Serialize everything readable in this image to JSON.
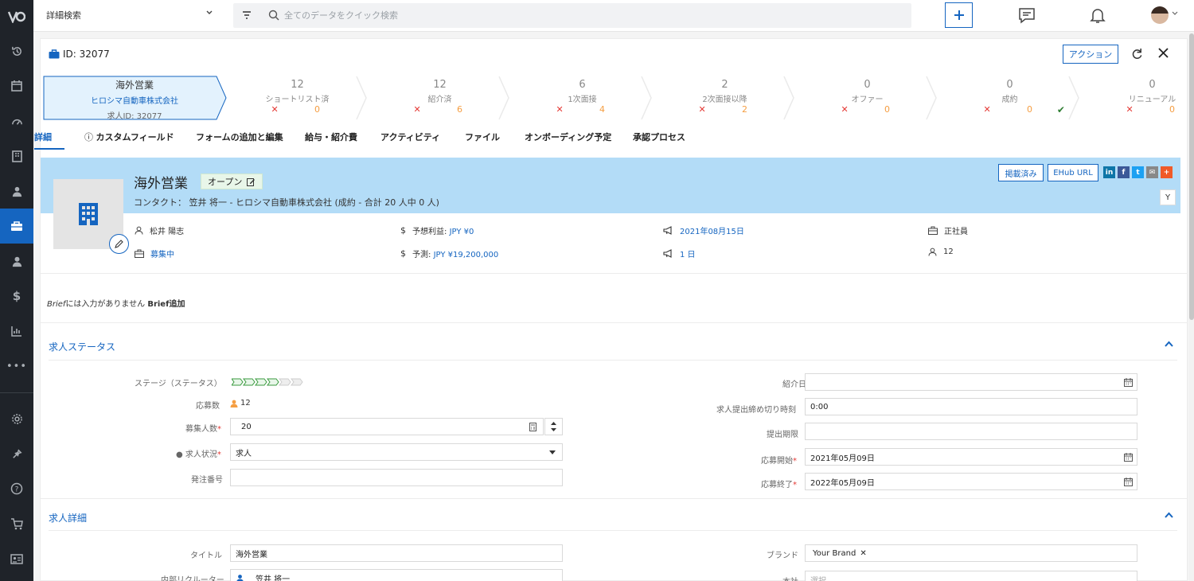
{
  "topbar": {
    "search_type": "詳細検索",
    "quick_search_placeholder": "全てのデータをクイック検索"
  },
  "header": {
    "id_label": "ID: 32077",
    "action_button": "アクション"
  },
  "pipeline": {
    "first": {
      "title": "海外営業",
      "company": "ヒロシマ自動車株式会社",
      "job_id": "求人ID: 32077"
    },
    "stages": [
      {
        "count": "12",
        "name": "ショートリスト済",
        "num": "0",
        "ok": false
      },
      {
        "count": "12",
        "name": "紹介済",
        "num": "6",
        "ok": false
      },
      {
        "count": "6",
        "name": "1次面接",
        "num": "4",
        "ok": false
      },
      {
        "count": "2",
        "name": "2次面接以降",
        "num": "2",
        "ok": false
      },
      {
        "count": "0",
        "name": "オファー",
        "num": "0",
        "ok": false
      },
      {
        "count": "0",
        "name": "成約",
        "num": "0",
        "ok": true
      },
      {
        "count": "0",
        "name": "リニューアル",
        "num": "0",
        "ok": true
      }
    ]
  },
  "tabs": [
    "詳細",
    "カスタムフィールド",
    "フォームの追加と編集",
    "給与・紹介費",
    "アクティビティ",
    "ファイル",
    "オンボーディング予定",
    "承認プロセス"
  ],
  "banner": {
    "title": "海外営業",
    "status": "オープン",
    "contact": "コンタクト： 笠井 将一 - ヒロシマ自動車株式会社 (成約 - 合計 20 人中 0 人)",
    "posted_button": "掲載済み",
    "ehub_button": "EHub URL",
    "y_button": "Y"
  },
  "meta": {
    "owner": "松井 陽志",
    "profit_label": "予想利益:",
    "profit_value": "JPY ¥0",
    "date": "2021年08月15日",
    "employment": "正社員",
    "recruit_status": "募集中",
    "forecast_label": "予測:",
    "forecast_value": "JPY ¥19,200,000",
    "days": "1 日",
    "applicants": "12"
  },
  "brief": {
    "label": "Brief",
    "text": "には入力がありません",
    "add": "Brief追加"
  },
  "job_status": {
    "title": "求人ステータス",
    "stage_label": "ステージ（ステータス）",
    "applicants_label": "応募数",
    "applicants_value": "12",
    "headcount_label": "募集人数",
    "headcount_value": "20",
    "job_state_label": "求人状況",
    "job_state_value": "求人",
    "order_no_label": "発注番号",
    "order_no_value": "",
    "intro_date_label": "紹介日",
    "intro_date_value": "",
    "deadline_time_label": "求人提出締め切り時刻",
    "deadline_time_value": "0:00",
    "deadline_label": "提出期限",
    "deadline_value": "",
    "apply_start_label": "応募開始",
    "apply_start_value": "2021年05月09日",
    "apply_end_label": "応募終了",
    "apply_end_value": "2022年05月09日"
  },
  "job_detail": {
    "title": "求人詳細",
    "title_label": "タイトル",
    "title_value": "海外営業",
    "recruiter_label": "内部リクルーター",
    "recruiter_value": "笠井 将一",
    "brand_label": "ブランド",
    "brand_value": "Your Brand",
    "hq_label": "本社",
    "hq_placeholder": "選択"
  },
  "colors": {
    "accent": "#1565c0",
    "sidebar": "#1f2329",
    "banner": "#b3dcf7",
    "error": "#e53935",
    "warning": "#f59e42",
    "success": "#2e7d32"
  }
}
